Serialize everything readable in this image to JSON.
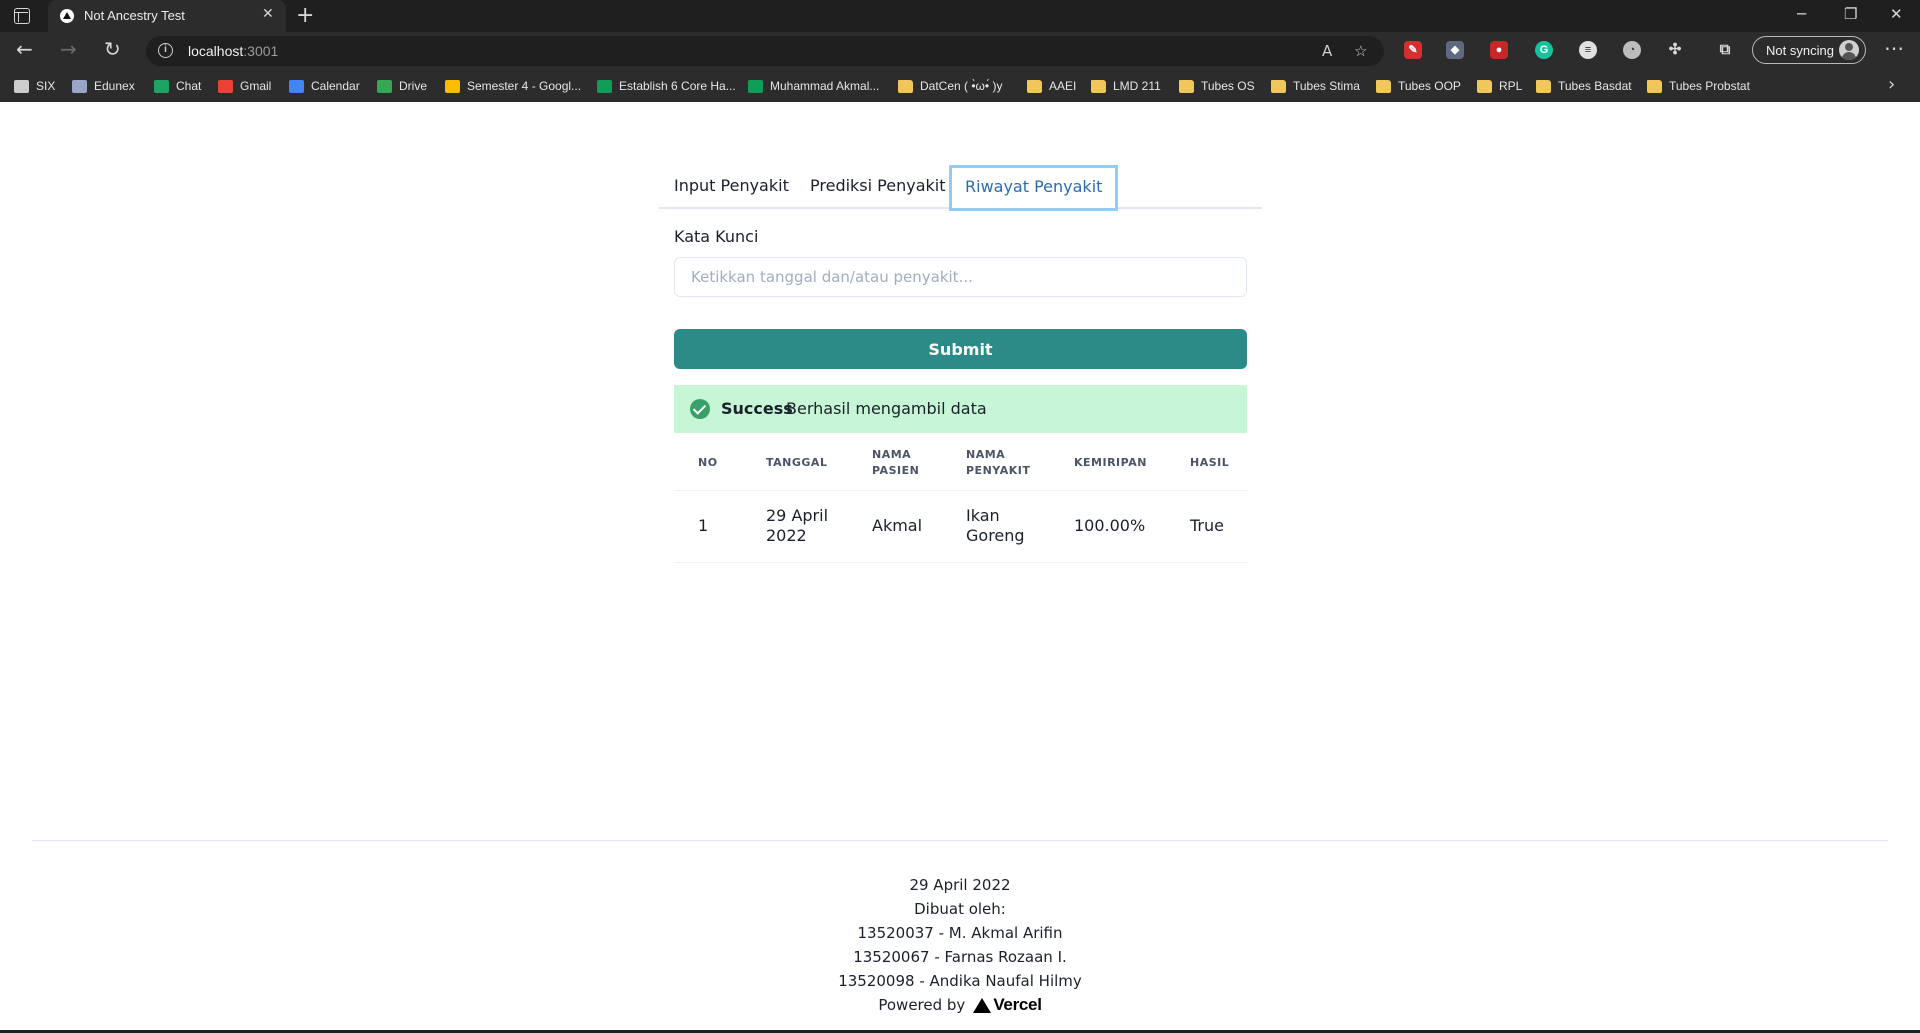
{
  "browser": {
    "tab_title": "Not Ancestry Test",
    "url_host": "localhost",
    "url_port": ":3001",
    "sync_label": "Not syncing",
    "bookmarks": [
      {
        "label": "SIX",
        "icon": "six-icon",
        "color": "#cccccc"
      },
      {
        "label": "Edunex",
        "icon": "edunex-icon",
        "color": "#9aa6c7"
      },
      {
        "label": "Chat",
        "icon": "chat-icon",
        "color": "#1ea362"
      },
      {
        "label": "Gmail",
        "icon": "gmail-icon",
        "color": "#ea4335"
      },
      {
        "label": "Calendar",
        "icon": "calendar-icon",
        "color": "#4285f4"
      },
      {
        "label": "Drive",
        "icon": "drive-icon",
        "color": "#34a853"
      },
      {
        "label": "Semester 4 - Googl...",
        "icon": "drive-icon",
        "color": "#fbbc04"
      },
      {
        "label": "Establish 6 Core Ha...",
        "icon": "sheets-icon",
        "color": "#0f9d58"
      },
      {
        "label": "Muhammad Akmal...",
        "icon": "sheets-icon",
        "color": "#0f9d58"
      },
      {
        "label": "DatCen ( •̀ω•́ )y",
        "icon": "folder-icon",
        "color": "#f1c75b"
      },
      {
        "label": "AAEI",
        "icon": "folder-icon",
        "color": "#f1c75b"
      },
      {
        "label": "LMD 211",
        "icon": "folder-icon",
        "color": "#f1c75b"
      },
      {
        "label": "Tubes OS",
        "icon": "folder-icon",
        "color": "#f1c75b"
      },
      {
        "label": "Tubes Stima",
        "icon": "folder-icon",
        "color": "#f1c75b"
      },
      {
        "label": "Tubes OOP",
        "icon": "folder-icon",
        "color": "#f1c75b"
      },
      {
        "label": "RPL",
        "icon": "folder-icon",
        "color": "#f1c75b"
      },
      {
        "label": "Tubes Basdat",
        "icon": "folder-icon",
        "color": "#f1c75b"
      },
      {
        "label": "Tubes Probstat",
        "icon": "folder-icon",
        "color": "#f1c75b"
      }
    ]
  },
  "page": {
    "tabs": [
      "Input Penyakit",
      "Prediksi Penyakit",
      "Riwayat Penyakit"
    ],
    "active_tab": "Riwayat Penyakit",
    "search": {
      "label": "Kata Kunci",
      "placeholder": "Ketikkan tanggal dan/atau penyakit...",
      "value": ""
    },
    "submit_label": "Submit",
    "alert": {
      "title": "Success",
      "description": "Berhasil mengambil data",
      "color": "#c6f6d5"
    },
    "table": {
      "headers": [
        "NO",
        "TANGGAL",
        "NAMA PASIEN",
        "NAMA PENYAKIT",
        "KEMIRIPAN",
        "HASIL"
      ],
      "rows": [
        [
          "1",
          "29 April 2022",
          "Akmal",
          "Ikan Goreng",
          "100.00%",
          "True"
        ]
      ]
    },
    "accent_color": "#2c8b86"
  },
  "footer": {
    "date": "29 April 2022",
    "made_by": "Dibuat oleh:",
    "authors": [
      "13520037 - M. Akmal Arifin",
      "13520067 - Farnas Rozaan I.",
      "13520098 - Andika Naufal Hilmy"
    ],
    "powered_by": "Powered by",
    "brand": "Vercel"
  }
}
